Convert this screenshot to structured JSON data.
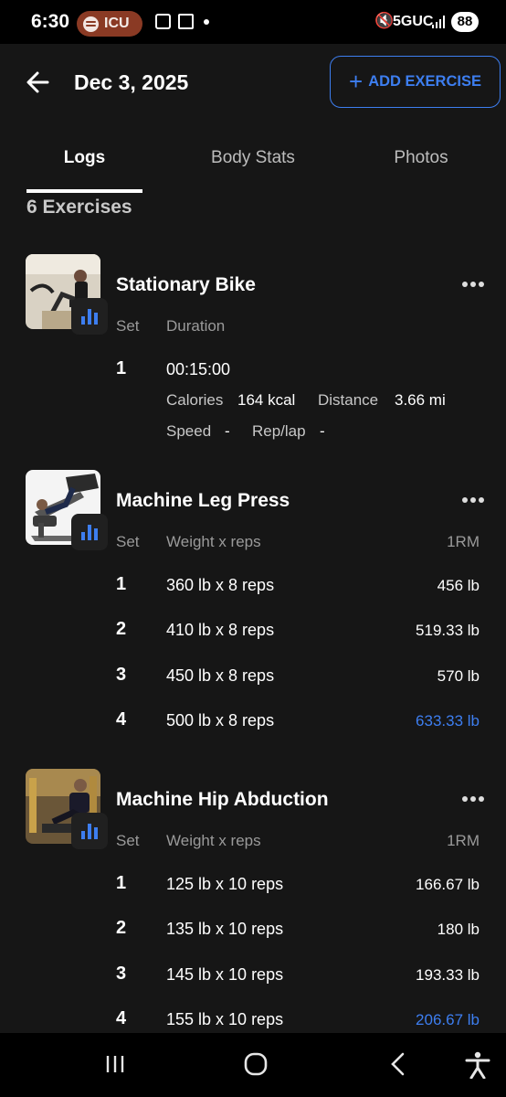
{
  "status": {
    "time": "6:30",
    "media_pill": "ICU",
    "network": "5GUC",
    "battery": "88"
  },
  "header": {
    "date": "Dec 3, 2025",
    "add_label": "ADD EXERCISE"
  },
  "tabs": [
    {
      "label": "Logs",
      "active": true
    },
    {
      "label": "Body Stats",
      "active": false
    },
    {
      "label": "Photos",
      "active": false
    }
  ],
  "exercise_count": "6 Exercises",
  "accent_color": "#3d7ef0",
  "exercises": [
    {
      "name": "Stationary Bike",
      "set_header": "Set",
      "col_header": "Duration",
      "sets": [
        {
          "num": "1",
          "value": "00:15:00"
        }
      ],
      "calories_label": "Calories",
      "calories": "164 kcal",
      "distance_label": "Distance",
      "distance": "3.66 mi",
      "speed_label": "Speed",
      "speed": "-",
      "replap_label": "Rep/lap",
      "replap": "-"
    },
    {
      "name": "Machine Leg Press",
      "set_header": "Set",
      "col_header": "Weight x reps",
      "rm_header": "1RM",
      "sets": [
        {
          "num": "1",
          "value": "360 lb x 8 reps",
          "rm": "456 lb"
        },
        {
          "num": "2",
          "value": "410 lb x 8 reps",
          "rm": "519.33 lb"
        },
        {
          "num": "3",
          "value": "450 lb x 8 reps",
          "rm": "570 lb"
        },
        {
          "num": "4",
          "value": "500 lb x 8 reps",
          "rm": "633.33 lb"
        }
      ]
    },
    {
      "name": "Machine Hip Abduction",
      "set_header": "Set",
      "col_header": "Weight x reps",
      "rm_header": "1RM",
      "sets": [
        {
          "num": "1",
          "value": "125 lb x 10 reps",
          "rm": "166.67 lb"
        },
        {
          "num": "2",
          "value": "135 lb x 10 reps",
          "rm": "180 lb"
        },
        {
          "num": "3",
          "value": "145 lb x 10 reps",
          "rm": "193.33 lb"
        },
        {
          "num": "4",
          "value": "155 lb x 10 reps",
          "rm": "206.67 lb"
        }
      ]
    }
  ]
}
